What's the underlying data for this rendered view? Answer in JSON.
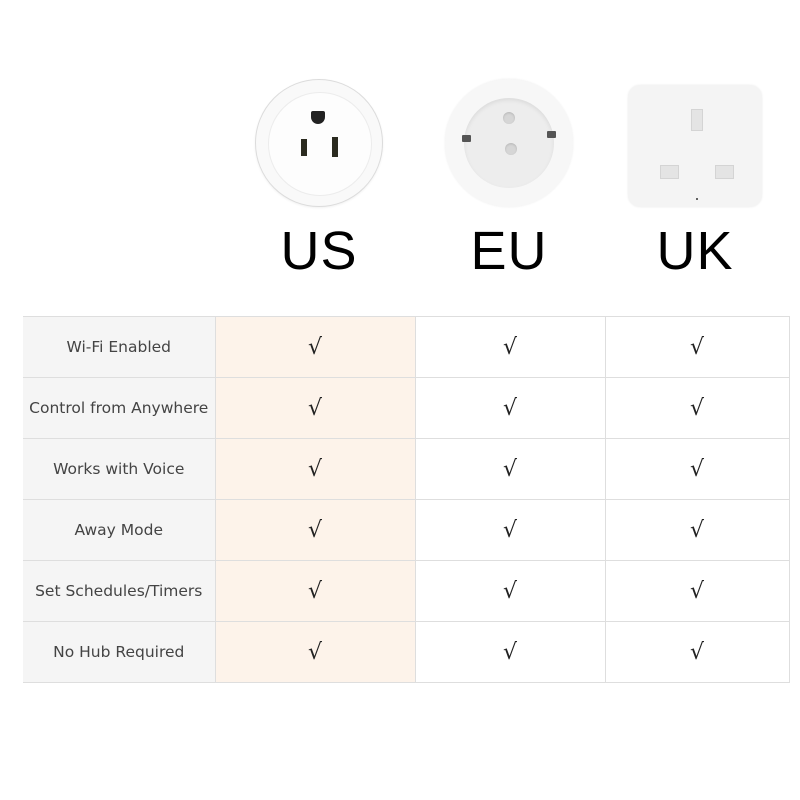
{
  "products": [
    {
      "id": "us",
      "label": "US",
      "icon": "us-socket-icon"
    },
    {
      "id": "eu",
      "label": "EU",
      "icon": "eu-socket-icon"
    },
    {
      "id": "uk",
      "label": "UK",
      "icon": "uk-socket-icon"
    }
  ],
  "colors": {
    "highlight_column": "#fdf3ea",
    "feature_column": "#f5f5f5",
    "grid": "#dedede"
  },
  "check_symbol": "√",
  "features": [
    {
      "label": "Wi-Fi Enabled",
      "us": "√",
      "eu": "√",
      "uk": "√"
    },
    {
      "label": "Control from Anywhere",
      "us": "√",
      "eu": "√",
      "uk": "√"
    },
    {
      "label": "Works with Voice",
      "us": "√",
      "eu": "√",
      "uk": "√"
    },
    {
      "label": "Away Mode",
      "us": "√",
      "eu": "√",
      "uk": "√"
    },
    {
      "label": "Set Schedules/Timers",
      "us": "√",
      "eu": "√",
      "uk": "√"
    },
    {
      "label": "No Hub Required",
      "us": "√",
      "eu": "√",
      "uk": "√"
    }
  ]
}
